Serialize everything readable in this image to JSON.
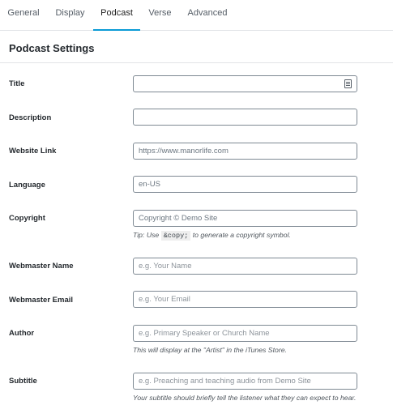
{
  "tabs": [
    {
      "label": "General"
    },
    {
      "label": "Display"
    },
    {
      "label": "Podcast"
    },
    {
      "label": "Verse"
    },
    {
      "label": "Advanced"
    }
  ],
  "active_tab": "Podcast",
  "section": {
    "title": "Podcast Settings"
  },
  "fields": {
    "title": {
      "label": "Title",
      "value": "",
      "icon": "list-icon"
    },
    "description": {
      "label": "Description",
      "value": ""
    },
    "website_link": {
      "label": "Website Link",
      "value": "https://www.manorlife.com"
    },
    "language": {
      "label": "Language",
      "value": "en-US"
    },
    "copyright": {
      "label": "Copyright",
      "value": "Copyright © Demo Site",
      "tip_prefix": "Tip: Use",
      "tip_code": "&copy;",
      "tip_suffix": "to generate a copyright symbol."
    },
    "webmaster_name": {
      "label": "Webmaster Name",
      "placeholder": "e.g. Your Name"
    },
    "webmaster_email": {
      "label": "Webmaster Email",
      "placeholder": "e.g. Your Email"
    },
    "author": {
      "label": "Author",
      "placeholder": "e.g. Primary Speaker or Church Name",
      "help": "This will display at the \"Artist\" in the iTunes Store."
    },
    "subtitle": {
      "label": "Subtitle",
      "placeholder": "e.g. Preaching and teaching audio from Demo Site",
      "help": "Your subtitle should briefly tell the listener what they can expect to hear."
    }
  },
  "colors": {
    "accent": "#0a9bd6",
    "border": "#7e8993"
  }
}
